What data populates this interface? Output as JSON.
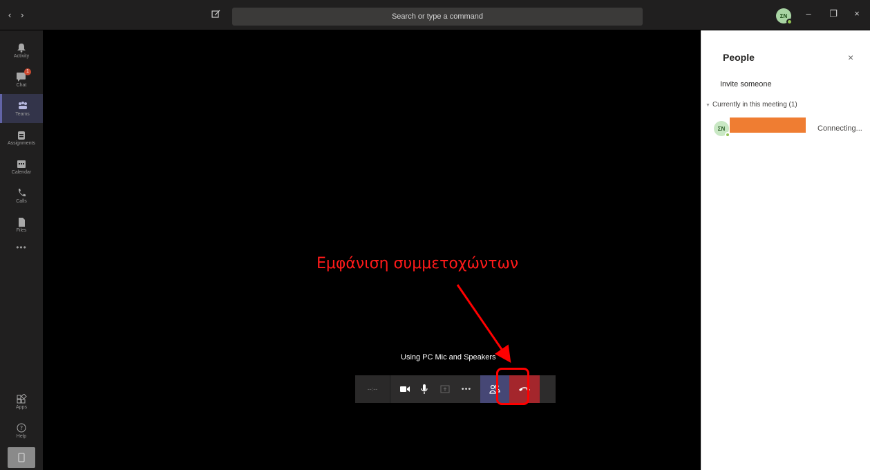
{
  "titlebar": {
    "search_placeholder": "Search or type a command",
    "user_initials": "ΣΝ"
  },
  "rail": {
    "items": [
      {
        "label": "Activity",
        "icon": "bell-icon"
      },
      {
        "label": "Chat",
        "icon": "chat-icon",
        "badge": "1"
      },
      {
        "label": "Teams",
        "icon": "teams-icon",
        "active": true
      },
      {
        "label": "Assignments",
        "icon": "assignments-icon"
      },
      {
        "label": "Calendar",
        "icon": "calendar-icon"
      },
      {
        "label": "Calls",
        "icon": "phone-icon"
      },
      {
        "label": "Files",
        "icon": "file-icon"
      }
    ],
    "more": "•••",
    "apps_label": "Apps",
    "help_label": "Help"
  },
  "stage": {
    "annotation": "Εμφάνιση συμμετοχώντων",
    "audio_status": "Using PC Mic and Speakers",
    "timer": "--:--"
  },
  "panel": {
    "title": "People",
    "invite": "Invite someone",
    "section": "Currently in this meeting (1)",
    "participant_initials": "ΣΝ",
    "participant_status": "Connecting..."
  },
  "colors": {
    "accent": "#6264a7",
    "hangup": "#a4262c",
    "annotation": "#ff0000",
    "redaction": "#ef7d32"
  }
}
